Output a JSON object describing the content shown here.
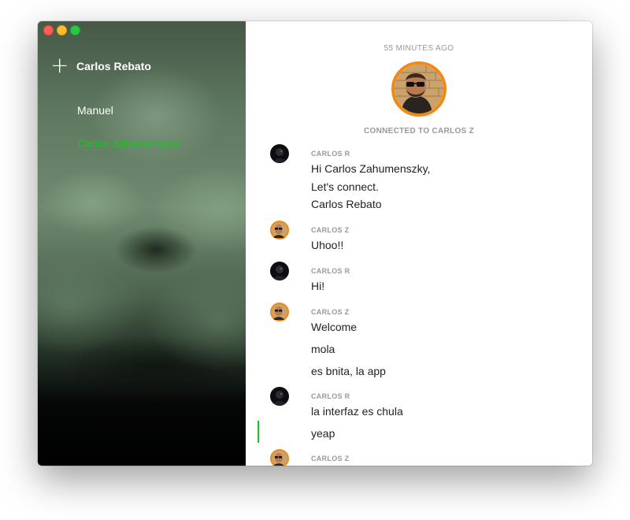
{
  "window": {
    "controls": [
      "close",
      "minimize",
      "zoom"
    ]
  },
  "sidebar": {
    "add_icon": "plus-icon",
    "user_name": "Carlos Rebato",
    "contacts": [
      {
        "name": "Manuel",
        "active": false
      },
      {
        "name": "Carlos Zahumenszky",
        "active": true
      }
    ]
  },
  "chat": {
    "timestamp": "55 MINUTES AGO",
    "connected_label": "CONNECTED TO CARLOS Z",
    "messages": [
      {
        "sender": "CARLOS R",
        "lines": [
          "Hi Carlos Zahumenszky,",
          "Let's connect.",
          "Carlos Rebato"
        ]
      },
      {
        "sender": "CARLOS Z",
        "lines": [
          "Uhoo!!"
        ]
      },
      {
        "sender": "CARLOS R",
        "lines": [
          "Hi!"
        ]
      },
      {
        "sender": "CARLOS Z",
        "lines": [
          "Welcome",
          "mola",
          "es bnita, la app"
        ]
      },
      {
        "sender": "CARLOS R",
        "lines": [
          "la interfaz es chula",
          "yeap"
        ]
      },
      {
        "sender": "CARLOS Z",
        "lines": []
      }
    ]
  },
  "colors": {
    "accent": "#17c41e",
    "avatar_ring": "#f08a16"
  }
}
